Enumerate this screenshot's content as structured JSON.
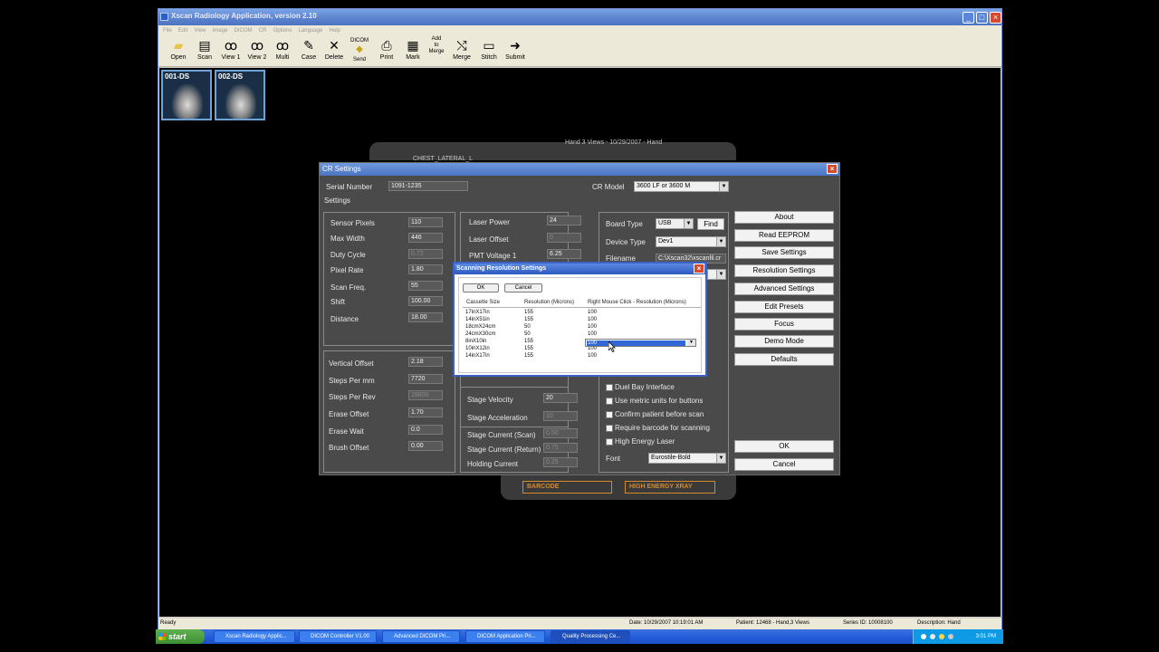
{
  "app": {
    "title": "Xscan Radiology Application, version 2.10",
    "menu": [
      "File",
      "Edit",
      "View",
      "Image",
      "DICOM",
      "CR",
      "Options",
      "Language",
      "Help"
    ],
    "toolbar": [
      {
        "label": "Open",
        "icon": "folder-icon"
      },
      {
        "label": "Scan",
        "icon": "scanner-icon"
      },
      {
        "label": "View 1",
        "icon": "glasses-icon"
      },
      {
        "label": "View 2",
        "icon": "glasses-icon"
      },
      {
        "label": "Multi",
        "icon": "glasses-icon"
      },
      {
        "label": "Case",
        "icon": "case-icon"
      },
      {
        "label": "Delete",
        "icon": "delete-icon"
      },
      {
        "label": "DICOM Send",
        "icon": "dicom-send-icon"
      },
      {
        "label": "Print",
        "icon": "print-icon"
      },
      {
        "label": "Mark",
        "icon": "mark-icon"
      },
      {
        "label": "Add to Merge",
        "icon": "add-merge-icon"
      },
      {
        "label": "Merge",
        "icon": "merge-icon"
      },
      {
        "label": "Stitch",
        "icon": "stitch-icon"
      },
      {
        "label": "Submit",
        "icon": "submit-icon"
      }
    ],
    "thumbnails": [
      "001-DS",
      "002-DS"
    ],
    "status": {
      "ready": "Ready",
      "date": "Date: 10/29/2007 10:19:01 AM",
      "patient": "Patient: 12468 - Hand,3 Views",
      "series": "Series ID: 10008100",
      "description": "Description: Hand"
    }
  },
  "viewer": {
    "header": "Hand 3 Views - 10/29/2007 - Hand",
    "sub": "CHEST_LATERAL_L",
    "barcode_label": "BARCODE",
    "high_energy_label": "HIGH ENERGY XRAY"
  },
  "cr_settings": {
    "title": "CR Settings",
    "serial_label": "Serial Number",
    "serial_value": "1091-1235",
    "settings_label": "Settings",
    "cr_model_label": "CR Model",
    "cr_model_value": "3600 LF or 3600 M",
    "left_fields": [
      {
        "label": "Sensor Pixels",
        "value": "110",
        "disabled": false
      },
      {
        "label": "Max Width",
        "value": "446",
        "disabled": false
      },
      {
        "label": "Duty Cycle",
        "value": "0.72",
        "disabled": true
      },
      {
        "label": "Pixel Rate",
        "value": "1.80",
        "disabled": false
      },
      {
        "label": "Scan Freq.",
        "value": "55",
        "disabled": false
      },
      {
        "label": "Shift",
        "value": "100.00",
        "disabled": false
      },
      {
        "label": "Distance",
        "value": "18.00",
        "disabled": false
      }
    ],
    "left_fields2": [
      {
        "label": "Vertical Offset",
        "value": "2.18",
        "disabled": false
      },
      {
        "label": "Steps Per mm",
        "value": "7720",
        "disabled": false
      },
      {
        "label": "Steps Per Rev",
        "value": "28800",
        "disabled": true
      },
      {
        "label": "Erase Offset",
        "value": "1.70",
        "disabled": false
      },
      {
        "label": "Erase Wait",
        "value": "0.0",
        "disabled": false
      },
      {
        "label": "Brush Offset",
        "value": "0.00",
        "disabled": false
      }
    ],
    "mid_fields": [
      {
        "label": "Laser Power",
        "value": "24",
        "disabled": false
      },
      {
        "label": "Laser Offset",
        "value": "0",
        "disabled": true
      },
      {
        "label": "PMT Voltage 1",
        "value": "6.25",
        "disabled": false
      }
    ],
    "mid_fields2": [
      {
        "label": "Stage Velocity",
        "value": "20",
        "disabled": false
      },
      {
        "label": "Stage Acceleration",
        "value": "10",
        "disabled": true
      },
      {
        "label": "Stage Current (Scan)",
        "value": "0.50",
        "disabled": true
      },
      {
        "label": "Stage Current (Return)",
        "value": "0.75",
        "disabled": true
      },
      {
        "label": "Holding Current",
        "value": "0.25",
        "disabled": true
      }
    ],
    "board_type_label": "Board Type",
    "board_type_value": "USB",
    "find_label": "Find",
    "device_type_label": "Device Type",
    "device_type_value": "Dev1",
    "filename_label": "Filename",
    "filename_value": "C:\\Xscan32\\xscanfil.cr",
    "checkboxes": [
      "Duel Bay Interface",
      "Use metric units for buttons",
      "Confirm patient before scan",
      "Require barcode for scanning",
      "High Energy Laser"
    ],
    "font_label": "Font",
    "font_value": "Eurostile-Bold",
    "right_buttons": [
      "About",
      "Read EEPROM",
      "Save Settings",
      "Resolution Settings",
      "Advanced Settings",
      "Edit Presets",
      "Focus",
      "Demo Mode",
      "Defaults"
    ],
    "ok_label": "OK",
    "cancel_label": "Cancel"
  },
  "scan_res": {
    "title": "Scanning Resolution Settings",
    "ok_label": "OK",
    "cancel_label": "Cancel",
    "headers": [
      "Cassette Size",
      "Resolution (Microns)",
      "Right Mouse Click - Resolution (Microns)"
    ],
    "rows": [
      [
        "17inX17in",
        "155",
        "100"
      ],
      [
        "14inX51in",
        "155",
        "100"
      ],
      [
        "18cmX24cm",
        "50",
        "100"
      ],
      [
        "24cmX30cm",
        "50",
        "100"
      ],
      [
        "8inX10in",
        "155",
        "100"
      ],
      [
        "10inX12in",
        "155",
        "100"
      ],
      [
        "14inX17in",
        "155",
        "100"
      ]
    ],
    "dropdown_value": "100"
  },
  "taskbar": {
    "start_label": "start",
    "tasks": [
      "Xscan Radiology Applic...",
      "DICOM Controller V1.00",
      "Advanced DICOM Pri...",
      "DICOM Application Pri...",
      "Quality Processing Ce..."
    ],
    "clock": "3:01 PM"
  }
}
